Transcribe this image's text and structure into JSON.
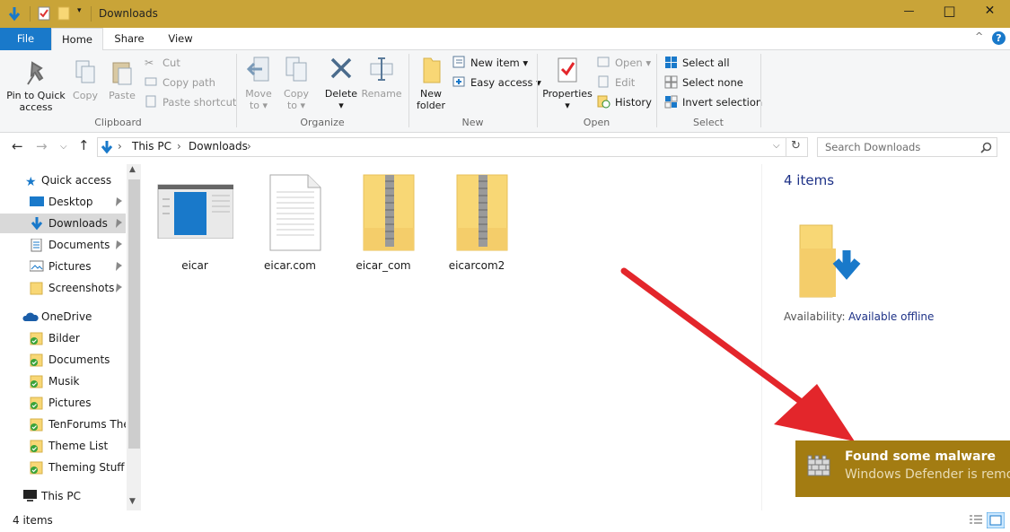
{
  "window": {
    "title": "Downloads"
  },
  "titlebar": {
    "minimize": "—",
    "maximize": "□",
    "close": "✕"
  },
  "ribbon_tabs": {
    "file": "File",
    "home": "Home",
    "share": "Share",
    "view": "View",
    "help": "?",
    "collapse": "^"
  },
  "clipboard": {
    "pin_label_1": "Pin to Quick",
    "pin_label_2": "access",
    "copy": "Copy",
    "paste": "Paste",
    "cut": "Cut",
    "copy_path": "Copy path",
    "paste_shortcut": "Paste shortcut",
    "group": "Clipboard"
  },
  "organize": {
    "move_1": "Move",
    "move_2": "to ▾",
    "copy_1": "Copy",
    "copy_2": "to ▾",
    "delete": "Delete",
    "delete_arrow": "▾",
    "rename": "Rename",
    "group": "Organize"
  },
  "new": {
    "folder_1": "New",
    "folder_2": "folder",
    "new_item": "New item ▾",
    "easy_access": "Easy access ▾",
    "group": "New"
  },
  "open": {
    "properties": "Properties",
    "properties_arrow": "▾",
    "open": "Open ▾",
    "edit": "Edit",
    "history": "History",
    "group": "Open"
  },
  "select": {
    "select_all": "Select all",
    "select_none": "Select none",
    "invert": "Invert selection",
    "group": "Select"
  },
  "address": {
    "back": "←",
    "forward": "→",
    "recent": "⌵",
    "up": "↑",
    "crumb_this_pc": "This PC",
    "crumb_downloads": "Downloads",
    "sep": "›",
    "dropdown": "⌵",
    "refresh": "↻",
    "search_placeholder": "Search Downloads"
  },
  "nav": {
    "quick_access": "Quick access",
    "desktop": "Desktop",
    "downloads": "Downloads",
    "documents": "Documents",
    "pictures": "Pictures",
    "screenshots": "Screenshots",
    "onedrive": "OneDrive",
    "od_bilder": "Bilder",
    "od_documents": "Documents",
    "od_musik": "Musik",
    "od_pictures": "Pictures",
    "od_tenforums": "TenForums Ther",
    "od_themelist": "Theme List",
    "od_theming": "Theming Stuff",
    "this_pc": "This PC"
  },
  "files": [
    "eicar",
    "eicar.com",
    "eicar_com",
    "eicarcom2"
  ],
  "preview": {
    "count": "4 items",
    "availability_label": "Availability:",
    "availability_value": "Available offline"
  },
  "status": {
    "count": "4 items"
  },
  "toast": {
    "title": "Found some malware",
    "body": "Windows Defender is remov"
  },
  "colors": {
    "title_bar": "#c9a438",
    "file_tab": "#1979ca",
    "toast": "#a37c12",
    "arrow": "#e3262b",
    "folder": "#f8d775",
    "selection": "#cce8ff"
  }
}
